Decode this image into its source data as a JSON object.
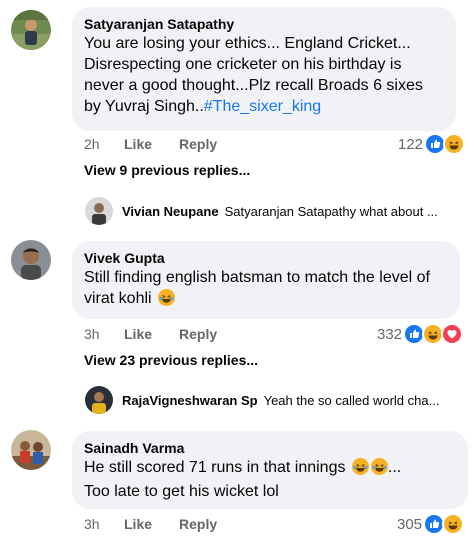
{
  "comments": [
    {
      "author": "Satyaranjan Satapathy",
      "text_plain": "You are losing your ethics... England Cricket... Disrespecting one cricketer on his birthday is never a good thought...Plz recall Broads 6 sixes by Yuvraj Singh..",
      "hashtag": "#The_sixer_king",
      "time": "2h",
      "like_label": "Like",
      "reply_label": "Reply",
      "reaction_count": "122",
      "reactions": [
        "like-icon",
        "haha-icon"
      ],
      "view_more": "View 9 previous replies...",
      "reply": {
        "author": "Vivian Neupane",
        "text": "Satyaranjan Satapathy what about ..."
      }
    },
    {
      "author": "Vivek Gupta",
      "text_plain": "Still finding english  batsman to match the  level of virat kohli",
      "emojis": [
        "laughing-emoji"
      ],
      "time": "3h",
      "like_label": "Like",
      "reply_label": "Reply",
      "reaction_count": "332",
      "reactions": [
        "like-icon",
        "haha-icon",
        "love-icon"
      ],
      "view_more": "View 23 previous replies...",
      "reply": {
        "author": "RajaVigneshwaran Sp",
        "text": "Yeah the so called world cha..."
      }
    },
    {
      "author": "Sainadh Varma",
      "text_line1": "He still scored 71 runs in that innings",
      "text_line1_suffix": "...",
      "text_line2": "Too late to get his wicket lol",
      "emojis": [
        "laughing-emoji",
        "laughing-emoji"
      ],
      "time": "3h",
      "like_label": "Like",
      "reply_label": "Reply",
      "reaction_count": "305",
      "reactions": [
        "like-icon",
        "haha-icon"
      ]
    }
  ],
  "colors": {
    "link": "#1877f2",
    "bubble": "#f0f2f5",
    "meta": "#65676b",
    "like": "#1877f2",
    "haha": "#f7b125",
    "love": "#f33e58"
  }
}
